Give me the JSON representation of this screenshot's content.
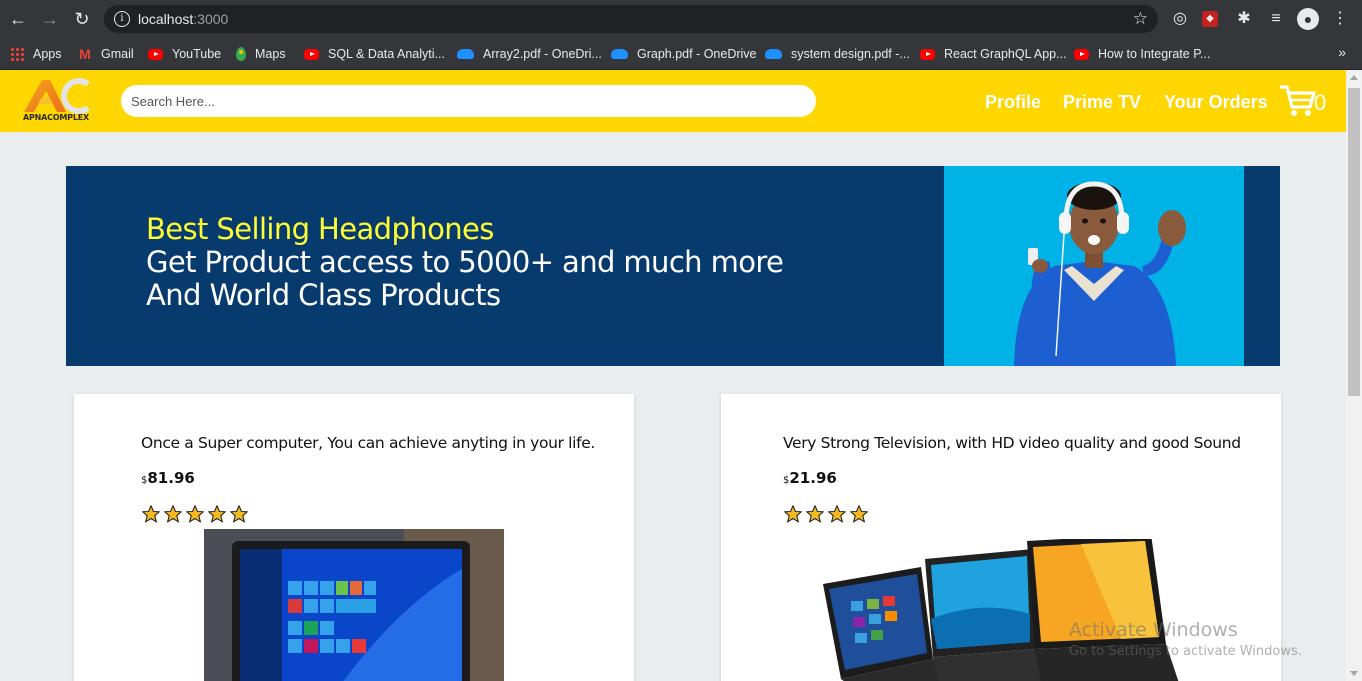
{
  "browser": {
    "url_host": "localhost",
    "url_port": ":3000",
    "bookmarks": [
      {
        "label": "Apps",
        "icon": "apps-grid-icon"
      },
      {
        "label": "Gmail",
        "icon": "gmail-icon"
      },
      {
        "label": "YouTube",
        "icon": "youtube-icon"
      },
      {
        "label": "Maps",
        "icon": "maps-pin-icon"
      },
      {
        "label": "SQL & Data Analyti...",
        "icon": "youtube-icon"
      },
      {
        "label": "Array2.pdf - OneDri...",
        "icon": "onedrive-icon"
      },
      {
        "label": "Graph.pdf - OneDrive",
        "icon": "onedrive-icon"
      },
      {
        "label": "system design.pdf -...",
        "icon": "onedrive-icon"
      },
      {
        "label": "React GraphQL App...",
        "icon": "youtube-icon"
      },
      {
        "label": "How to Integrate P...",
        "icon": "youtube-icon"
      }
    ],
    "more": "»"
  },
  "header": {
    "logo_text": "APNACOMPLEX",
    "search_placeholder": "Search Here...",
    "nav": [
      "Profile",
      "Prime TV",
      "Your Orders"
    ],
    "cart_count": "0",
    "background": "#ffd700"
  },
  "banner": {
    "line1": "Best Selling Headphones",
    "line2": "Get Product access to 5000+ and much more",
    "line3": "And World Class Products",
    "background": "#073b6e",
    "highlight": "#ffff33"
  },
  "products": [
    {
      "title": "Once a Super computer, You can achieve anyting in your life.",
      "currency": "$",
      "price": "81.96",
      "rating": 5
    },
    {
      "title": "Very Strong Television, with HD video quality and good Sound",
      "currency": "$",
      "price": "21.96",
      "rating": 4
    }
  ],
  "watermark": {
    "line1": "Activate Windows",
    "line2": "Go to Settings to activate Windows."
  }
}
